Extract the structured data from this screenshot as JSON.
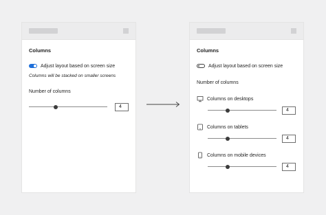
{
  "left": {
    "title": "Columns",
    "toggle_label": "Adjust layout based on screen size",
    "toggle_on": true,
    "note": "Columns will be stacked on smaller screens",
    "columns_label": "Number of columns",
    "columns_value": "4"
  },
  "right": {
    "title": "Columns",
    "toggle_label": "Adjust layout based on screen size",
    "toggle_on": false,
    "columns_label": "Number of columns",
    "devices": [
      {
        "label": "Columns on desktops",
        "icon": "desktop-icon",
        "value": "4"
      },
      {
        "label": "Columns on tablets",
        "icon": "tablet-icon",
        "value": "4"
      },
      {
        "label": "Columns on mobile devices",
        "icon": "mobile-icon",
        "value": "4"
      }
    ]
  },
  "colors": {
    "accent": "#1e6fd9",
    "background": "#f0f0f1",
    "panel": "#ffffff"
  }
}
